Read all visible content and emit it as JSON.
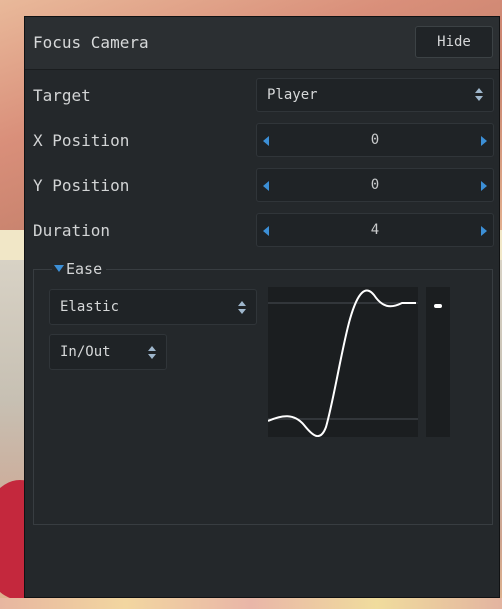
{
  "panel": {
    "title": "Focus Camera",
    "hide_label": "Hide"
  },
  "fields": {
    "target": {
      "label": "Target",
      "value": "Player"
    },
    "x_position": {
      "label": "X Position",
      "value": "0"
    },
    "y_position": {
      "label": "Y Position",
      "value": "0"
    },
    "duration": {
      "label": "Duration",
      "value": "4"
    }
  },
  "ease": {
    "label": "Ease",
    "type": "Elastic",
    "mode": "In/Out",
    "curve_color": "#ffffff"
  },
  "colors": {
    "accent": "#3c8fd6",
    "panel_bg": "#24282b"
  },
  "icons": {
    "spinner_left": "triangle-left",
    "spinner_right": "triangle-right",
    "select_updown": "up-down-arrows",
    "collapse": "triangle-down"
  }
}
